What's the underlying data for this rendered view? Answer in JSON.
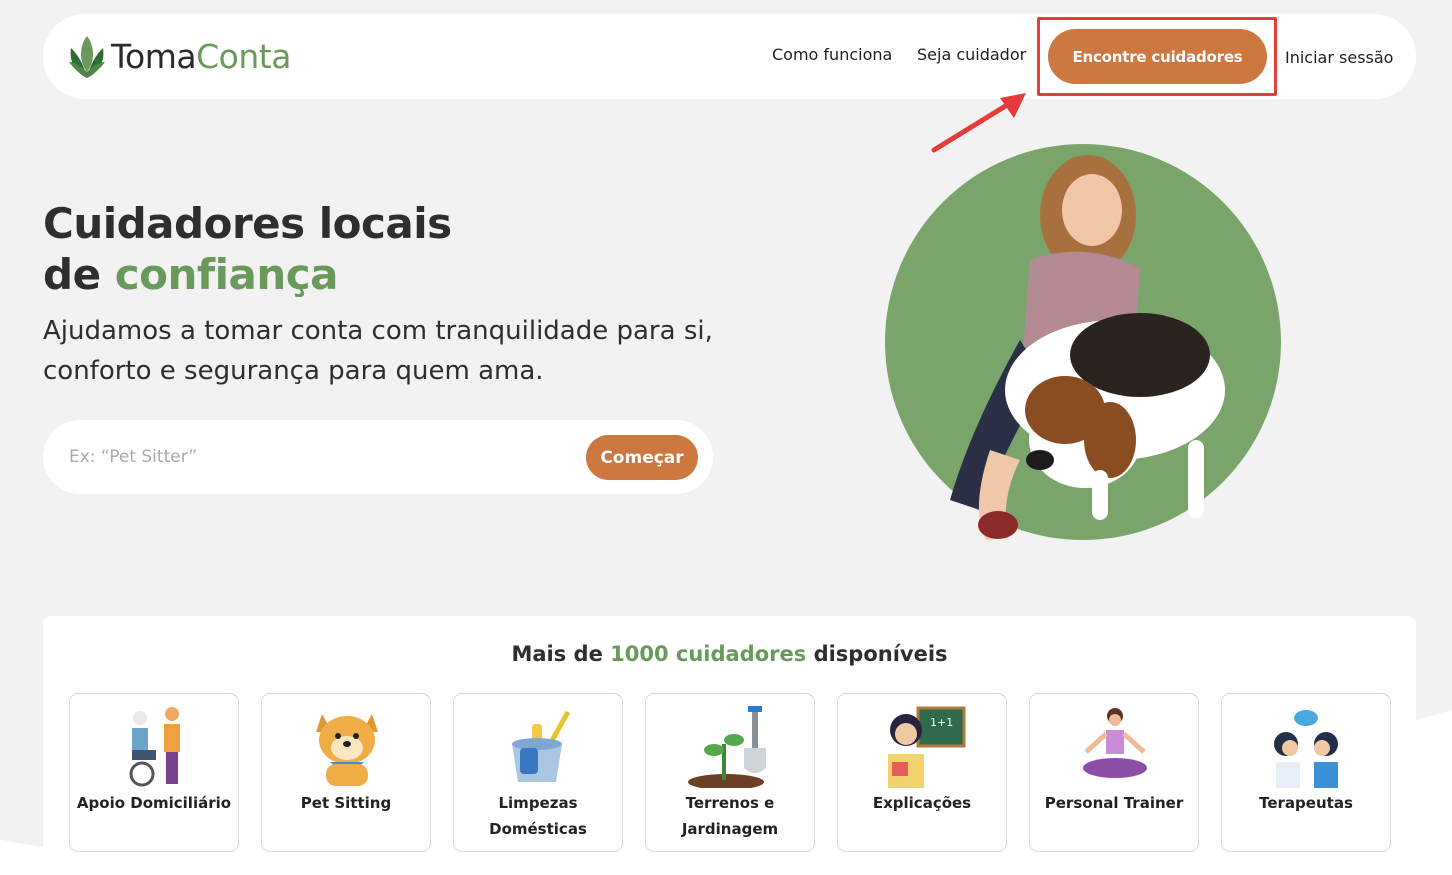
{
  "brand": {
    "part1": "Toma",
    "part2": "Conta",
    "accent_color": "#6a9a5b"
  },
  "nav": {
    "como_funciona": "Como funciona",
    "seja_cuidador": "Seja cuidador",
    "encontre": "Encontre cuidadores",
    "login": "Iniciar sessão"
  },
  "hero": {
    "title_line1": "Cuidadores locais",
    "title_line2_prefix": "de",
    "title_line2_accent": "confiança",
    "subtitle": "Ajudamos a tomar conta com tranquilidade para si, conforto e segurança para quem ama.",
    "search_placeholder": "Ex: “Pet Sitter”",
    "start_button": "Começar"
  },
  "categories": {
    "title_prefix": "Mais de",
    "title_accent": "1000 cuidadores",
    "title_suffix": "disponíveis",
    "items": [
      {
        "label": "Apoio Domiciliário",
        "icon": "elderly-care-icon"
      },
      {
        "label": "Pet Sitting",
        "icon": "dog-icon"
      },
      {
        "label": "Limpezas Domésticas",
        "icon": "cleaning-bucket-icon"
      },
      {
        "label": "Terrenos e Jardinagem",
        "icon": "gardening-icon"
      },
      {
        "label": "Explicações",
        "icon": "teacher-icon"
      },
      {
        "label": "Personal Trainer",
        "icon": "yoga-icon"
      },
      {
        "label": "Terapeutas",
        "icon": "therapy-icon"
      }
    ]
  },
  "colors": {
    "primary_button": "#cd7841",
    "highlight": "#e53b3b",
    "background": "#f1f2f1"
  }
}
